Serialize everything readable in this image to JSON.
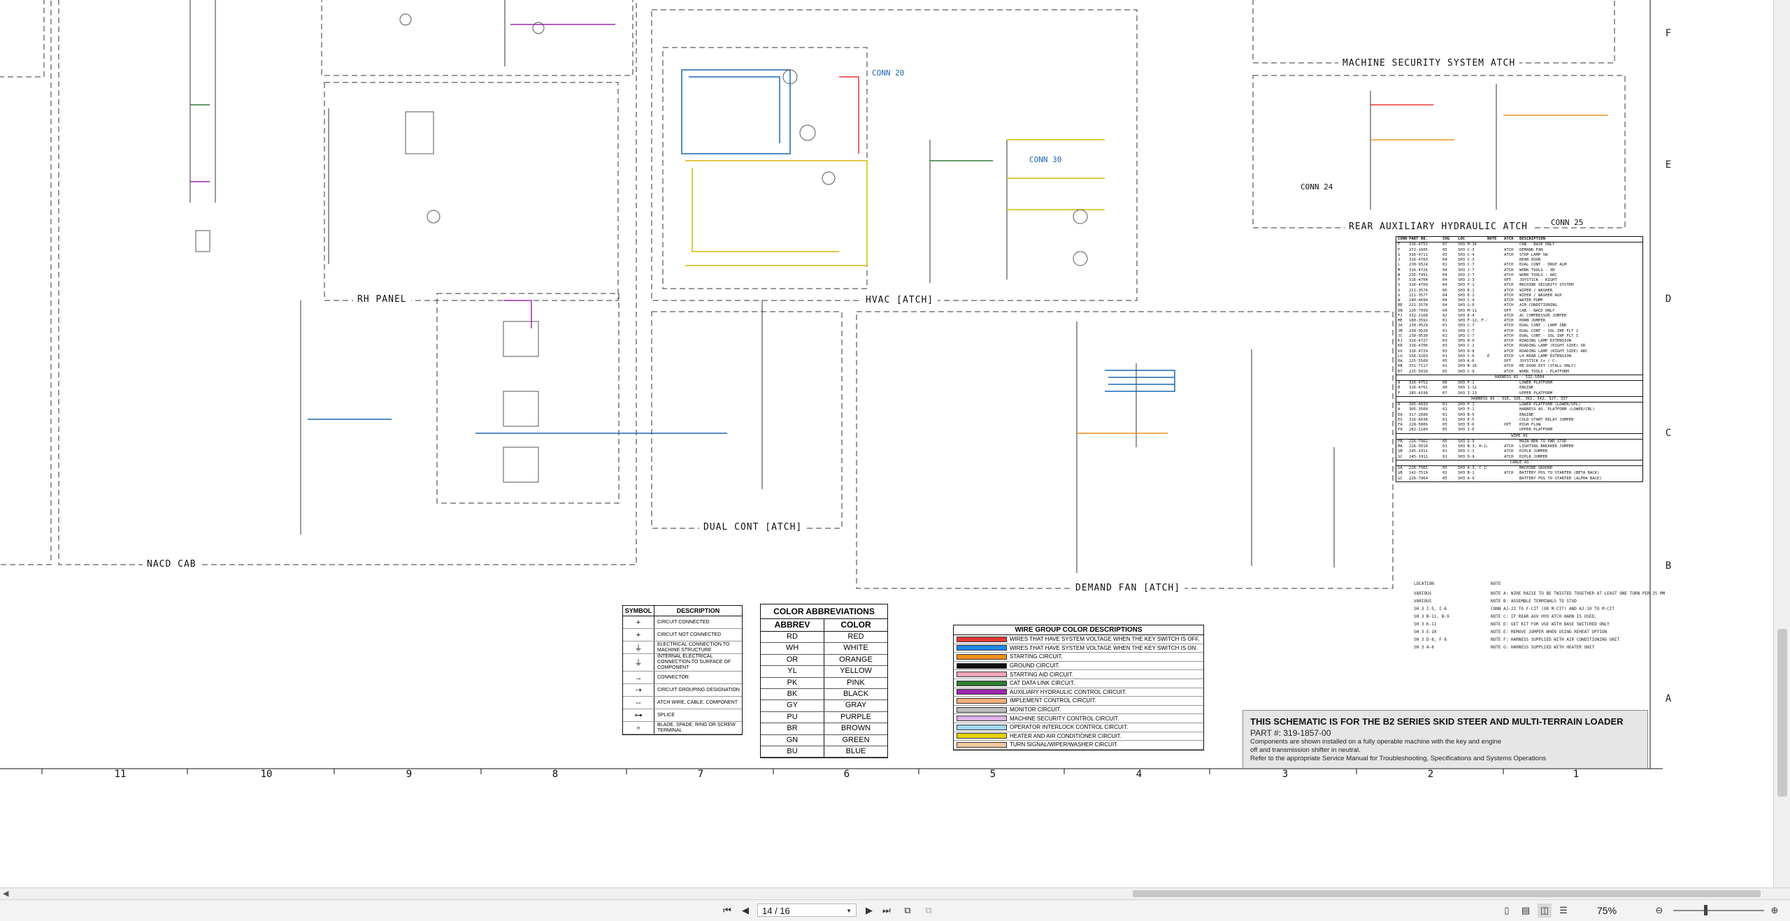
{
  "sheet": {
    "section_titles": {
      "rh_panel": "RH PANEL",
      "nacd_cab": "NACD CAB",
      "hvac": "HVAC [ATCH]",
      "dual_cont": "DUAL CONT [ATCH]",
      "demand_fan": "DEMAND FAN [ATCH]",
      "machine_security": "MACHINE SECURITY SYSTEM ATCH",
      "rear_aux": "REAR AUXILIARY HYDRAULIC ATCH"
    },
    "connectors": {
      "conn20": "CONN 20",
      "conn30": "CONN 30",
      "conn24": "CONN 24",
      "conn25": "CONN 25"
    },
    "row_labels": [
      "F",
      "E",
      "D",
      "C",
      "B",
      "A"
    ],
    "zone_numbers": [
      "11",
      "10",
      "9",
      "8",
      "7",
      "6",
      "5",
      "4",
      "3",
      "2",
      "1"
    ]
  },
  "symbol_table": {
    "col_symbol": "SYMBOL",
    "col_description": "DESCRIPTION",
    "rows": [
      {
        "symbol": "+",
        "description": "CIRCUIT CONNECTED"
      },
      {
        "symbol": "+",
        "description": "CIRCUIT NOT CONNECTED"
      },
      {
        "symbol": "⏚",
        "description": "ELECTRICAL CONNECTION TO MACHINE STRUCTURE"
      },
      {
        "symbol": "⏚",
        "description": "INTERNAL ELECTRICAL CONNECTION TO SURFACE OF COMPONENT"
      },
      {
        "symbol": "→",
        "description": "CONNECTOR"
      },
      {
        "symbol": "⇢",
        "description": "CIRCUIT GROUPING DESIGNATION"
      },
      {
        "symbol": "--",
        "description": "ATCH WIRE, CABLE, COMPONENT"
      },
      {
        "symbol": "⊶",
        "description": "SPLICE"
      },
      {
        "symbol": "∘",
        "description": "BLADE, SPADE, RING OR SCREW TERMINAL"
      }
    ]
  },
  "color_abbreviations": {
    "title": "COLOR ABBREVIATIONS",
    "col_abbrev": "ABBREV",
    "col_color": "COLOR",
    "rows": [
      {
        "abbrev": "RD",
        "color": "RED"
      },
      {
        "abbrev": "WH",
        "color": "WHITE"
      },
      {
        "abbrev": "OR",
        "color": "ORANGE"
      },
      {
        "abbrev": "YL",
        "color": "YELLOW"
      },
      {
        "abbrev": "PK",
        "color": "PINK"
      },
      {
        "abbrev": "BK",
        "color": "BLACK"
      },
      {
        "abbrev": "GY",
        "color": "GRAY"
      },
      {
        "abbrev": "PU",
        "color": "PURPLE"
      },
      {
        "abbrev": "BR",
        "color": "BROWN"
      },
      {
        "abbrev": "GN",
        "color": "GREEN"
      },
      {
        "abbrev": "BU",
        "color": "BLUE"
      }
    ]
  },
  "wire_group": {
    "title": "WIRE GROUP COLOR DESCRIPTIONS",
    "rows": [
      {
        "color": "#e53935",
        "text": "WIRES THAT HAVE SYSTEM VOLTAGE WHEN THE KEY SWITCH IS OFF."
      },
      {
        "color": "#1e88e5",
        "text": "WIRES THAT HAVE SYSTEM VOLTAGE WHEN THE KEY SWITCH IS ON."
      },
      {
        "color": "#f0901e",
        "text": "STARTING CIRCUIT."
      },
      {
        "color": "#111111",
        "text": "GROUND CIRCUIT."
      },
      {
        "color": "#f4a6b8",
        "text": "STARTING AID CIRCUIT."
      },
      {
        "color": "#2e7d32",
        "text": "CAT DATA LINK CIRCUIT."
      },
      {
        "color": "#9c27b0",
        "text": "AUXILIARY HYDRAULIC CONTROL CIRCUIT."
      },
      {
        "color": "#f5b07a",
        "text": "IMPLEMENT CONTROL CIRCUIT."
      },
      {
        "color": "#bdbdbd",
        "text": "MONITOR CIRCUIT."
      },
      {
        "color": "#ddb3e6",
        "text": "MACHINE SECURITY CONTROL CIRCUIT."
      },
      {
        "color": "#9ed7f0",
        "text": "OPERATOR INTERLOCK CONTROL CIRCUIT."
      },
      {
        "color": "#e6d200",
        "text": "HEATER AND AIR CONDITIONER CIRCUIT."
      },
      {
        "color": "#f2c9a0",
        "text": "TURN SIGNAL/WIPER/WASHER CIRCUIT."
      }
    ]
  },
  "title_block": {
    "title": "THIS SCHEMATIC IS FOR THE B2 SERIES SKID STEER AND MULTI-TERRAIN LOADER",
    "part": "PART #: 319-1857-00",
    "line1": "Components are shown installed on a fully operable machine with the key and engine",
    "line2": "off and transmission shifter in neutral.",
    "line3": "Refer to the appropriate Service Manual for Troubleshooting, Specifications and Systems Operations"
  },
  "parts_table": {
    "header": [
      "CONN",
      "PART NO.",
      "CHG",
      "LOC",
      "NOTE",
      "ATCH",
      "DESCRIPTION"
    ],
    "rows": [
      [
        "F",
        "316-4752",
        "07",
        "SH3 M-16",
        "",
        "",
        "CAB - BASE ONLY"
      ],
      [
        "T",
        "272-1605",
        "05",
        "SH3 C-3",
        "",
        "ATCH",
        "DEMAND FAN"
      ],
      [
        "G",
        "316-4711",
        "03",
        "SH3 C-4",
        "",
        "ATCH",
        "STOP LAMP SW"
      ],
      [
        "J",
        "316-4703",
        "04",
        "SH3 C-3",
        "",
        "",
        "REAR DOOR"
      ],
      [
        "L",
        "230-9524",
        "01",
        "SH3 C-7",
        "",
        "ATCH",
        "DUAL CONT - DRUP ALM"
      ],
      [
        "M",
        "316-4726",
        "04",
        "SH3 J-7",
        "",
        "ATCH",
        "WORK TOOLS - XR"
      ],
      [
        "N",
        "235-7991",
        "04",
        "SH3 J-7",
        "",
        "ATCH",
        "WORK TOOLS - ARC"
      ],
      [
        "P",
        "316-4704",
        "04",
        "SH3 J-3",
        "",
        "OPT",
        "JOYSTICK - RIGHT"
      ],
      [
        "S",
        "316-4709",
        "04",
        "SH3 F-1",
        "",
        "ATCH",
        "MACHINE SECURITY SYSTEM"
      ],
      [
        "U",
        "221-3576",
        "06",
        "SH3 E-1",
        "",
        "ATCH",
        "WIPER / WASHER"
      ],
      [
        "V",
        "221-3577",
        "04",
        "SH3 E-1",
        "",
        "ATCH",
        "WIPER / WASHER AUX"
      ],
      [
        "W",
        "180-4694",
        "04",
        "SH3 C-4",
        "",
        "ATCH",
        "WATER PUMP"
      ],
      [
        "BE",
        "221-3578",
        "04",
        "SH3 G-6",
        "",
        "ATCH",
        "AIR CONDITIONING"
      ],
      [
        "DN",
        "226-7999",
        "04",
        "SH3 M-11",
        "",
        "OPT",
        "CAB - NACD ONLY"
      ],
      [
        "FJ",
        "332-2168",
        "02",
        "SH3 E-4",
        "",
        "ATCH",
        "AC COMPRESSOR JUMPER"
      ],
      [
        "ME",
        "180-3592",
        "01",
        "SH3 F-12, F-15",
        "",
        "ATCH",
        "HORN JUMPER"
      ],
      [
        "JA",
        "230-9529",
        "01",
        "SH3 C-7",
        "",
        "ATCH",
        "DUAL CONT - LAMP IND"
      ],
      [
        "JB",
        "230-9528",
        "01",
        "SH3 C-7",
        "",
        "ATCH",
        "DUAL CONT - SOL INP FLT 2"
      ],
      [
        "JC",
        "230-9530",
        "01",
        "SH3 C-7",
        "",
        "ATCH",
        "DUAL CONT - SOL INP FLT 1"
      ],
      [
        "KJ",
        "316-4727",
        "03",
        "SH3 D-9",
        "",
        "ATCH",
        "ROADING LAMP EXTENSION"
      ],
      [
        "KR",
        "316-4706",
        "03",
        "SH3 C-2",
        "",
        "ATCH",
        "ROADING LAMP (RIGHT SIDE) XR"
      ],
      [
        "KX",
        "316-4729",
        "03",
        "SH3 D-8",
        "",
        "ATCH",
        "ROADING LAMP (RIGHT SIDE) ARC"
      ],
      [
        "LU",
        "156-3269",
        "01",
        "SH3 C-6",
        "E",
        "ATCH",
        "LH REAR LAMP EXTENSION"
      ],
      [
        "RA",
        "225-5509",
        "05",
        "SH3 K-6",
        "",
        "OPT",
        "JOYSTICK C+ / C-"
      ],
      [
        "RB",
        "331-7117",
        "02",
        "SH3 B-16",
        "",
        "ATCH",
        "RR DOOR EXT (STALL ONLY)"
      ],
      [
        "RT",
        "225-5010",
        "05",
        "SH3 C-9",
        "",
        "ATCH",
        "WORK TOOLS - PLATFORM"
      ]
    ],
    "sub1": "HARNESS AS - 332-1004",
    "rows2": [
      [
        "A",
        "316-4752",
        "06",
        "SH3 F-1",
        "",
        "",
        "LOWER PLATFORM"
      ],
      [
        "B",
        "316-4701",
        "08",
        "SH3 I-12",
        "",
        "",
        "ENGINE"
      ],
      [
        "F",
        "285-4198",
        "07",
        "SH3 I-13",
        "",
        "",
        "UPPER PLATFORM"
      ]
    ],
    "sub2": "HARNESS AS - 316, 326, 362, 342, 327, 337",
    "rows3": [
      [
        "A",
        "305-4039",
        "01",
        "SH3 F-1",
        "",
        "",
        "LOWER PLATFORM (LOWER/UPL)"
      ],
      [
        "A",
        "305-3560",
        "01",
        "SH3 F-1",
        "",
        "",
        "HARNESS AS. PLATFORM (LOWER/CBL)"
      ],
      [
        "EA",
        "317-2680",
        "01",
        "SH3 B-5",
        "",
        "",
        "ENGINE"
      ],
      [
        "ES",
        "316-8938",
        "01",
        "SH3 E-5",
        "",
        "",
        "COLD START RELAY JUMPER"
      ],
      [
        "FA",
        "228-5006",
        "05",
        "SH3 E-6",
        "",
        "OPT",
        "HIGH FLOW"
      ],
      [
        "PA",
        "282-1189",
        "05",
        "SH3 I-6",
        "",
        "",
        "UPPER PLATFORM"
      ]
    ],
    "sub3": "WIRE AS",
    "rows4": [
      [
        "FB",
        "226-7962",
        "05",
        "SH3 D-9",
        "",
        "",
        "MAIN BRK TO PWR STUD"
      ],
      [
        "MA",
        "226-5010",
        "01",
        "SH3 B-3, H-12",
        "",
        "ATCH",
        "LIGHTING BREAKER JUMPER"
      ],
      [
        "SB",
        "245-1911",
        "01",
        "SH3 C-1",
        "",
        "ATCH",
        "DIPLR JUMPER"
      ],
      [
        "SC",
        "245-1911",
        "01",
        "SH3 D-9",
        "",
        "ATCH",
        "DIPLR JUMPER"
      ]
    ],
    "sub4": "CABLE AS",
    "rows5": [
      [
        "GA",
        "226-7965",
        "05",
        "SH3 A-3, C-11",
        "",
        "",
        "MACHINE GROUND"
      ],
      [
        "GB",
        "142-7519",
        "02",
        "SH3 B-1",
        "",
        "ATCH",
        "BATTERY POS TO STARTER (BETA BACK)"
      ],
      [
        "GC",
        "226-7964",
        "05",
        "SH3 A-9",
        "",
        "",
        "BATTERY POS TO STARTER (ALPHA BACK)"
      ]
    ]
  },
  "notes": {
    "header_loc": "LOCATION",
    "header_note": "NOTE",
    "rows": [
      [
        "VARIOUS",
        "NOTE A: WIRE RAISE TO BE TWISTED TOGETHER AT LEAST ONE TURN PER 25 MM"
      ],
      [
        "VARIOUS",
        "NOTE B: ASSEMBLE TERMINALS TO STUD"
      ],
      [
        "SH 3 I-5, I-6",
        "CONN AJ-22 TO F-CIT (OR M-CIT) AND AJ-10 TO M-CIT"
      ],
      [
        "SH 3 B-11, B-9",
        "NOTE C: IF REAR AUX HYD ATCH HARN IS USED,"
      ],
      [
        "SH 3 K-11",
        "NOTE D: GET KIT FOR USE WITH BASE SWITCHED ONLY"
      ],
      [
        "SH 3 E-10",
        "NOTE E: REMOVE JUMPER WHEN USING REHEAT OPTION"
      ],
      [
        "SH 3 D-8, F-8",
        "NOTE F: HARNESS SUPPLIED WITH AIR CONDITIONING UNIT"
      ],
      [
        "SH 3 A-8",
        "NOTE G: HARNESS SUPPLIED WITH HEATER UNIT"
      ]
    ]
  },
  "toolbar": {
    "page_value": "14 / 16",
    "zoom_value": "75%"
  }
}
